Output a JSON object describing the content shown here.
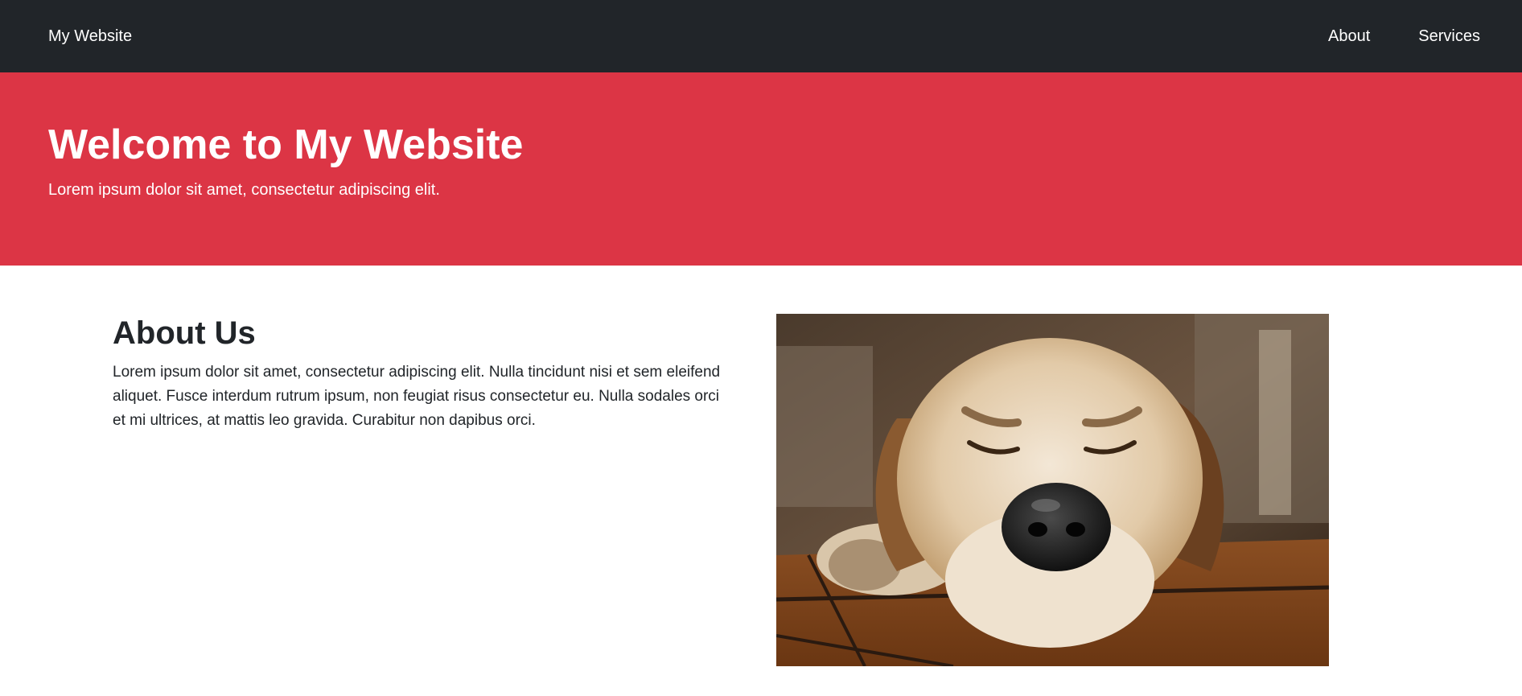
{
  "nav": {
    "brand": "My Website",
    "links": [
      {
        "label": "About"
      },
      {
        "label": "Services"
      }
    ],
    "background": "#212529"
  },
  "hero": {
    "title": "Welcome to My Website",
    "subtitle": "Lorem ipsum dolor sit amet, consectetur adipiscing elit.",
    "background": "#dc3545"
  },
  "about": {
    "heading": "About Us",
    "body": "Lorem ipsum dolor sit amet, consectetur adipiscing elit. Nulla tincidunt nisi et sem eleifend aliquet. Fusce interdum rutrum ipsum, non feugiat risus consectetur eu. Nulla sodales orci et mi ultrices, at mattis leo gravida. Curabitur non dapibus orci."
  },
  "photo": {
    "subject": "dog-photo"
  }
}
